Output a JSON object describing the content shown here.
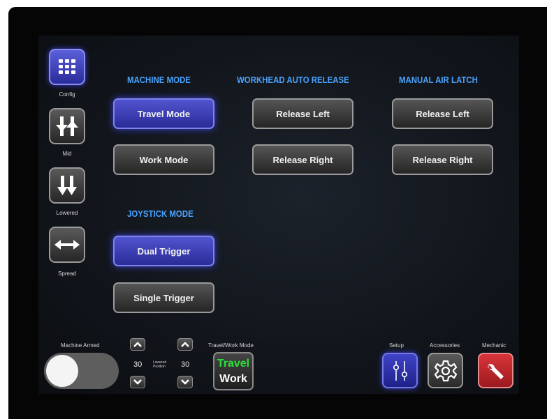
{
  "sidebar": {
    "items": [
      {
        "label": "Config",
        "icon": "grid-icon",
        "active": true
      },
      {
        "label": "Mid",
        "icon": "mid-position-icon",
        "active": false
      },
      {
        "label": "Lowered",
        "icon": "lowered-arrows-icon",
        "active": false
      },
      {
        "label": "Spread",
        "icon": "spread-arrows-icon",
        "active": false
      }
    ]
  },
  "machine_mode": {
    "heading": "MACHINE MODE",
    "travel": "Travel Mode",
    "work": "Work Mode",
    "selected": "Travel Mode"
  },
  "workhead_auto_release": {
    "heading": "WORKHEAD AUTO RELEASE",
    "left": "Release Left",
    "right": "Release Right"
  },
  "manual_air_latch": {
    "heading": "MANUAL AIR LATCH",
    "left": "Release Left",
    "right": "Release Right"
  },
  "joystick_mode": {
    "heading": "JOYSTICK MODE",
    "dual": "Dual Trigger",
    "single": "Single Trigger",
    "selected": "Dual Trigger"
  },
  "footer": {
    "machine_armed_label": "Machine Armed",
    "machine_armed_on": false,
    "lowered_position_label": "Lowered Position",
    "left_value": "30",
    "right_value": "30",
    "travel_work_label": "Travel/Work Mode",
    "travel_text": "Travel",
    "work_text": "Work",
    "setup_label": "Setup",
    "accessories_label": "Accessories",
    "mechanic_label": "Mechanic"
  },
  "colors": {
    "accent_blue": "#4aa3ff",
    "active_button": "#3d42d6",
    "travel_green": "#29e03a",
    "mechanic_red": "#c8262c"
  }
}
